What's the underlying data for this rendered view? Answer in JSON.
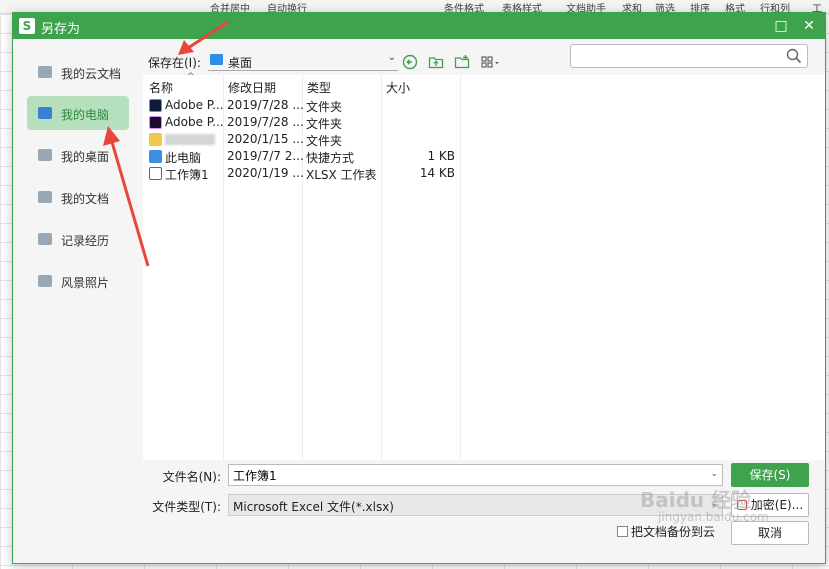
{
  "background": {
    "toolbar_items": [
      "合并居中",
      "自动换行",
      "条件格式",
      "表格样式",
      "文档助手",
      "求和",
      "筛选",
      "排序",
      "格式",
      "行和列",
      "工"
    ]
  },
  "dialog": {
    "title": "另存为",
    "logo_letter": "S",
    "maximize_label": "□",
    "close_label": "✕"
  },
  "sidebar": {
    "items": [
      {
        "label": "我的云文档",
        "icon": "cloud-cube-icon"
      },
      {
        "label": "我的电脑",
        "icon": "computer-icon"
      },
      {
        "label": "我的桌面",
        "icon": "desktop-icon"
      },
      {
        "label": "我的文档",
        "icon": "folder-icon"
      },
      {
        "label": "记录经历",
        "icon": "folder-icon"
      },
      {
        "label": "风景照片",
        "icon": "folder-icon"
      }
    ],
    "active_index": 1
  },
  "location": {
    "label": "保存在(I):",
    "value": "桌面"
  },
  "search": {
    "placeholder": ""
  },
  "file_list": {
    "headers": {
      "name": "名称",
      "date": "修改日期",
      "type": "类型",
      "size": "大小"
    },
    "rows": [
      {
        "name": "Adobe P...",
        "date": "2019/7/28 ...",
        "type": "文件夹",
        "size": "",
        "icon": "adobe-ps-icon"
      },
      {
        "name": "Adobe P...",
        "date": "2019/7/28 ...",
        "type": "文件夹",
        "size": "",
        "icon": "adobe-pr-icon"
      },
      {
        "name": "",
        "date": "2020/1/15 ...",
        "type": "文件夹",
        "size": "",
        "icon": "folder-icon"
      },
      {
        "name": "此电脑",
        "date": "2019/7/7 2...",
        "type": "快捷方式",
        "size": "1 KB",
        "icon": "computer-shortcut-icon"
      },
      {
        "name": "工作簿1",
        "date": "2020/1/19 ...",
        "type": "XLSX 工作表",
        "size": "14 KB",
        "icon": "xlsx-icon"
      }
    ]
  },
  "bottom": {
    "filename_label": "文件名(N):",
    "filename_value": "工作簿1",
    "filetype_label": "文件类型(T):",
    "filetype_value": "Microsoft Excel 文件(*.xlsx)",
    "save_label": "保存(S)",
    "encrypt_label": "加密(E)...",
    "cancel_label": "取消",
    "cloud_backup_label": "把文档备份到云"
  },
  "watermark": {
    "text": "Baidu 经验",
    "subtext": "jingyan.baidu.com"
  },
  "colors": {
    "accent": "#3fa34d",
    "active_bg": "#b6e0bd",
    "arrow": "#e8463a"
  }
}
